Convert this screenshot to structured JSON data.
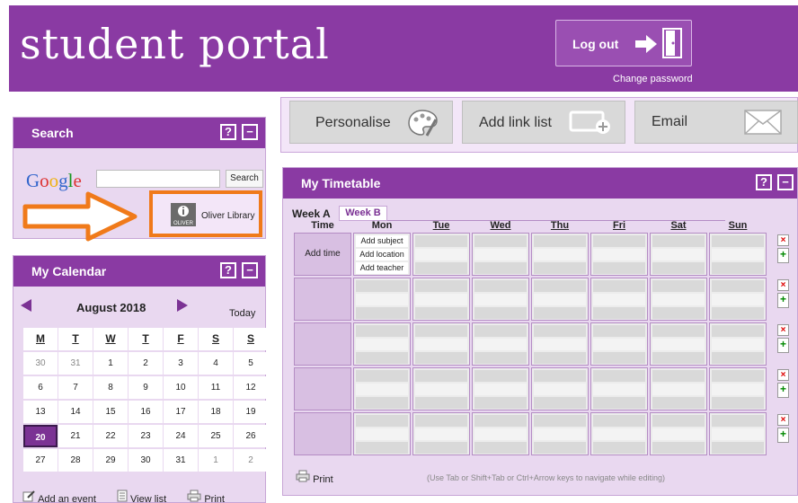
{
  "header": {
    "brand": "student portal",
    "logout": "Log out",
    "change_password": "Change password"
  },
  "toolbar": {
    "personalise": "Personalise",
    "add_link_list": "Add link list",
    "email": "Email"
  },
  "search": {
    "title": "Search",
    "google": "Google",
    "button": "Search",
    "input_value": "",
    "oliver": "Oliver Library"
  },
  "calendar": {
    "title": "My Calendar",
    "month": "August 2018",
    "today": "Today",
    "dow": [
      "M",
      "T",
      "W",
      "T",
      "F",
      "S",
      "S"
    ],
    "weeks": [
      [
        "30",
        "31",
        "1",
        "2",
        "3",
        "4",
        "5"
      ],
      [
        "6",
        "7",
        "8",
        "9",
        "10",
        "11",
        "12"
      ],
      [
        "13",
        "14",
        "15",
        "16",
        "17",
        "18",
        "19"
      ],
      [
        "20",
        "21",
        "22",
        "23",
        "24",
        "25",
        "26"
      ],
      [
        "27",
        "28",
        "29",
        "30",
        "31",
        "1",
        "2"
      ]
    ],
    "selected": "20",
    "add_event": "Add an event",
    "view_list": "View list",
    "print": "Print"
  },
  "timetable": {
    "title": "My Timetable",
    "week_a": "Week A",
    "week_b": "Week B",
    "time_label": "Time",
    "days": [
      "Mon",
      "Tue",
      "Wed",
      "Thu",
      "Fri",
      "Sat",
      "Sun"
    ],
    "add_time": "Add time",
    "add_subject": "Add subject",
    "add_location": "Add location",
    "add_teacher": "Add teacher",
    "print": "Print",
    "hint": "(Use Tab or Shift+Tab or Ctrl+Arrow keys to navigate while editing)"
  },
  "colors": {
    "brand": "#8a3aa3",
    "panel": "#e9d8f0",
    "highlight": "#f07a1a"
  }
}
